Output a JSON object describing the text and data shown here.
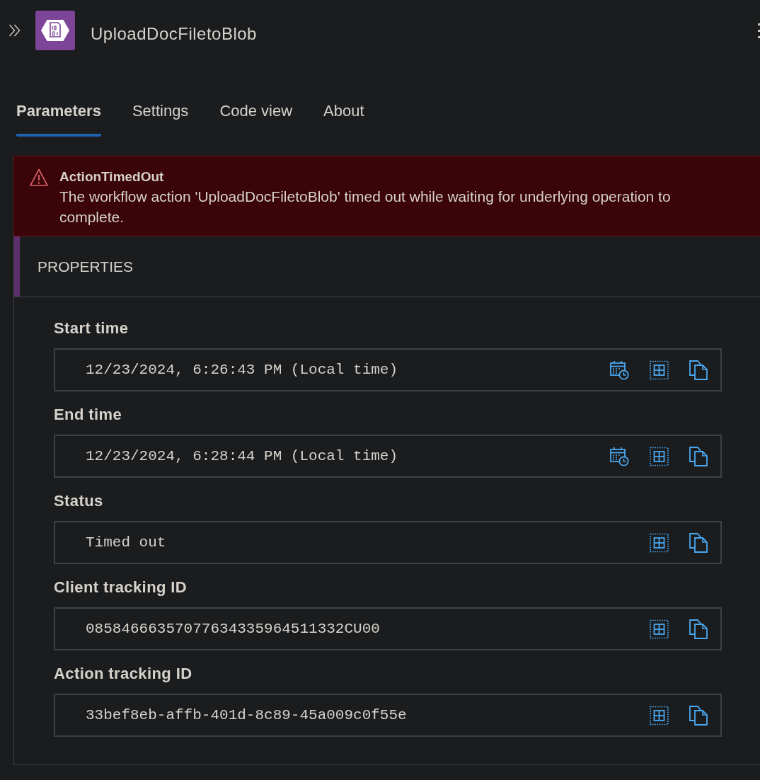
{
  "header": {
    "title": "UploadDocFiletoBlob"
  },
  "tabs": [
    {
      "label": "Parameters",
      "selected": true
    },
    {
      "label": "Settings",
      "selected": false
    },
    {
      "label": "Code view",
      "selected": false
    },
    {
      "label": "About",
      "selected": false
    }
  ],
  "error": {
    "title": "ActionTimedOut",
    "message": "The workflow action 'UploadDocFiletoBlob' timed out while waiting for underlying operation to complete."
  },
  "properties": {
    "title": "PROPERTIES",
    "fields": [
      {
        "label": "Start time",
        "value": "12/23/2024, 6:26:43 PM (Local time)",
        "kind": "datetime"
      },
      {
        "label": "End time",
        "value": "12/23/2024, 6:28:44 PM (Local time)",
        "kind": "datetime"
      },
      {
        "label": "Status",
        "value": "Timed out",
        "kind": "text"
      },
      {
        "label": "Client tracking ID",
        "value": "08584666357077634335964511332CU00",
        "kind": "text"
      },
      {
        "label": "Action tracking ID",
        "value": "33bef8eb-affb-401d-8c89-45a009c0f55e",
        "kind": "text"
      }
    ]
  }
}
